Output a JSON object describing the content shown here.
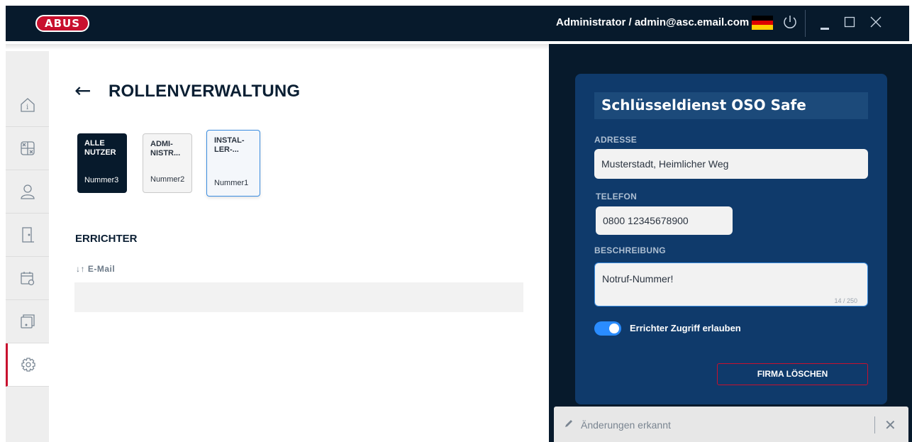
{
  "titlebar": {
    "logo": "ABUS",
    "user": "Administrator / admin@asc.email.com",
    "icons": [
      "germany-flag",
      "power-icon",
      "minimize-icon",
      "maximize-icon",
      "close-icon"
    ]
  },
  "sidebar": {
    "items": [
      {
        "name": "info-icon"
      },
      {
        "name": "calculator-icon"
      },
      {
        "name": "user-icon"
      },
      {
        "name": "door-icon"
      },
      {
        "name": "calendar-icon"
      },
      {
        "name": "device-icon"
      },
      {
        "name": "settings-icon",
        "active": true
      }
    ]
  },
  "main": {
    "back_arrow": "←",
    "title": "ROLLENVERWALTUNG",
    "roles": [
      {
        "label_line1": "ALLE",
        "label_line2": "NUTZER",
        "number": "Nummer3",
        "state": "selected-dark"
      },
      {
        "label_line1": "ADMI-",
        "label_line2": "NISTR...",
        "number": "Nummer2",
        "state": "default"
      },
      {
        "label_line1": "INSTAL-",
        "label_line2": "LER-...",
        "number": "Nummer1",
        "state": "focused"
      }
    ],
    "section_title": "ERRICHTER",
    "column_header": "↓↑ E-Mail"
  },
  "panel": {
    "company_name": "Schlüsseldienst OSO Safe",
    "address_label": "ADRESSE",
    "address_value": "Musterstadt, Heimlicher Weg",
    "phone_label": "TELEFON",
    "phone_value": "0800 12345678900",
    "description_label": "BESCHREIBUNG",
    "description_value": "Notruf-Nummer!",
    "description_counter": "14 / 250",
    "toggle_label": "Errichter Zugriff erlauben",
    "toggle_on": true,
    "delete_button": "FIRMA LÖSCHEN"
  },
  "toast": {
    "text": "Änderungen erkannt",
    "close": "✕"
  },
  "colors": {
    "brand_red": "#c8102e",
    "navy": "#071a2c",
    "panel_blue": "#0f3a6b",
    "toggle_blue": "#2a8cff"
  }
}
